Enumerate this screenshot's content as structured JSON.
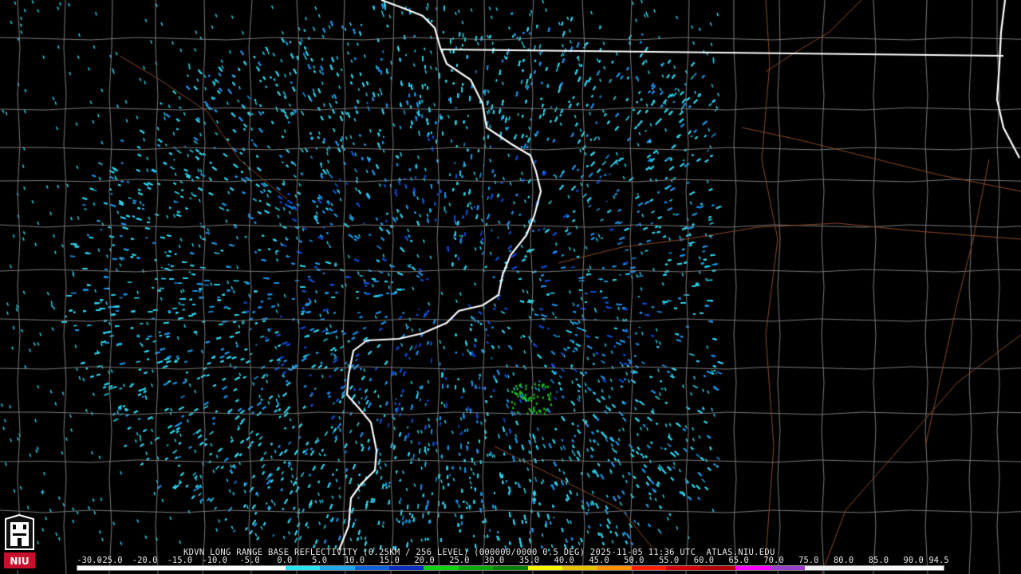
{
  "product": {
    "caption": "KDVN LONG RANGE BASE REFLECTIVITY (0.25KM / 256 LEVEL) (000000/0000 0.5 DEG) 2025-11-05 11:36 UTC  ATLAS.NIU.EDU"
  },
  "logo": {
    "text": "NIU",
    "color": "#c8102e"
  },
  "legend": {
    "labels": [
      "-30.0",
      "-25.0",
      "-20.0",
      "-15.0",
      "-10.0",
      "-5.0",
      "0.0",
      "5.0",
      "10.0",
      "15.0",
      "20.0",
      "25.0",
      "30.0",
      "35.0",
      "40.0",
      "45.0",
      "50.0",
      "55.0",
      "60.0",
      "65.0",
      "70.0",
      "75.0",
      "80.0",
      "85.0",
      "90.0",
      "94.5"
    ],
    "colors": [
      "#ffffff",
      "#ffffff",
      "#ffffff",
      "#ffffff",
      "#ffffff",
      "#ffffff",
      "#29e3f0",
      "#1fa7e8",
      "#1060d8",
      "#0a2fc0",
      "#12d012",
      "#0aa80a",
      "#088008",
      "#f6f600",
      "#e8c000",
      "#ff9000",
      "#ff2000",
      "#d00000",
      "#b00000",
      "#ff00ff",
      "#9a40c8",
      "#f0f0f0",
      "#f4f4f4",
      "#f8f8f8",
      "#fcfcfc"
    ]
  },
  "map_colors": {
    "background": "#000000",
    "county_lines": "#7a7a7a",
    "state_lines": "#ffffff",
    "roads": "#8b4a2c",
    "echo_light": "#2ad0e8",
    "echo_mid": "#1b8fe0",
    "echo_dark": "#0d4bd0",
    "echo_green": "#18c818"
  }
}
